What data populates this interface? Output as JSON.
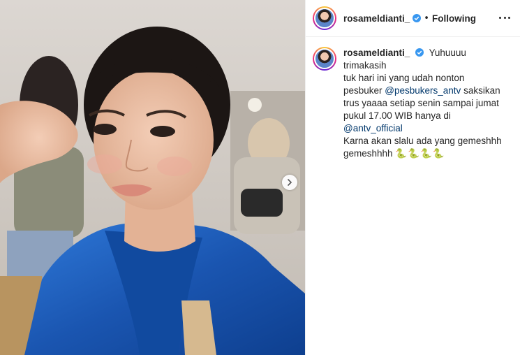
{
  "post": {
    "username": "rosameldianti_",
    "follow_status": "Following",
    "separator": "•",
    "caption_lines": [
      "Yuhuuuu trimakasih",
      "tuk hari ini yang udah nonton",
      "saksikan",
      "trus yaaaa setiap senin sampai jumat",
      "pukul 17.00 WIB hanya di",
      "Karna akan slalu ada yang gemeshhh",
      "gemeshhhh"
    ],
    "mention_1": "@pesbukers_antv",
    "mention_2": "@antv_official",
    "emoji": "🐍🐍🐍🐍"
  },
  "colors": {
    "link": "#00376b",
    "verified": "#3897f0",
    "text": "#262626",
    "dress": "#1f5fb8"
  },
  "icons": {
    "verified": "verified-badge-icon",
    "more": "more-options-icon",
    "next": "chevron-right-icon"
  }
}
